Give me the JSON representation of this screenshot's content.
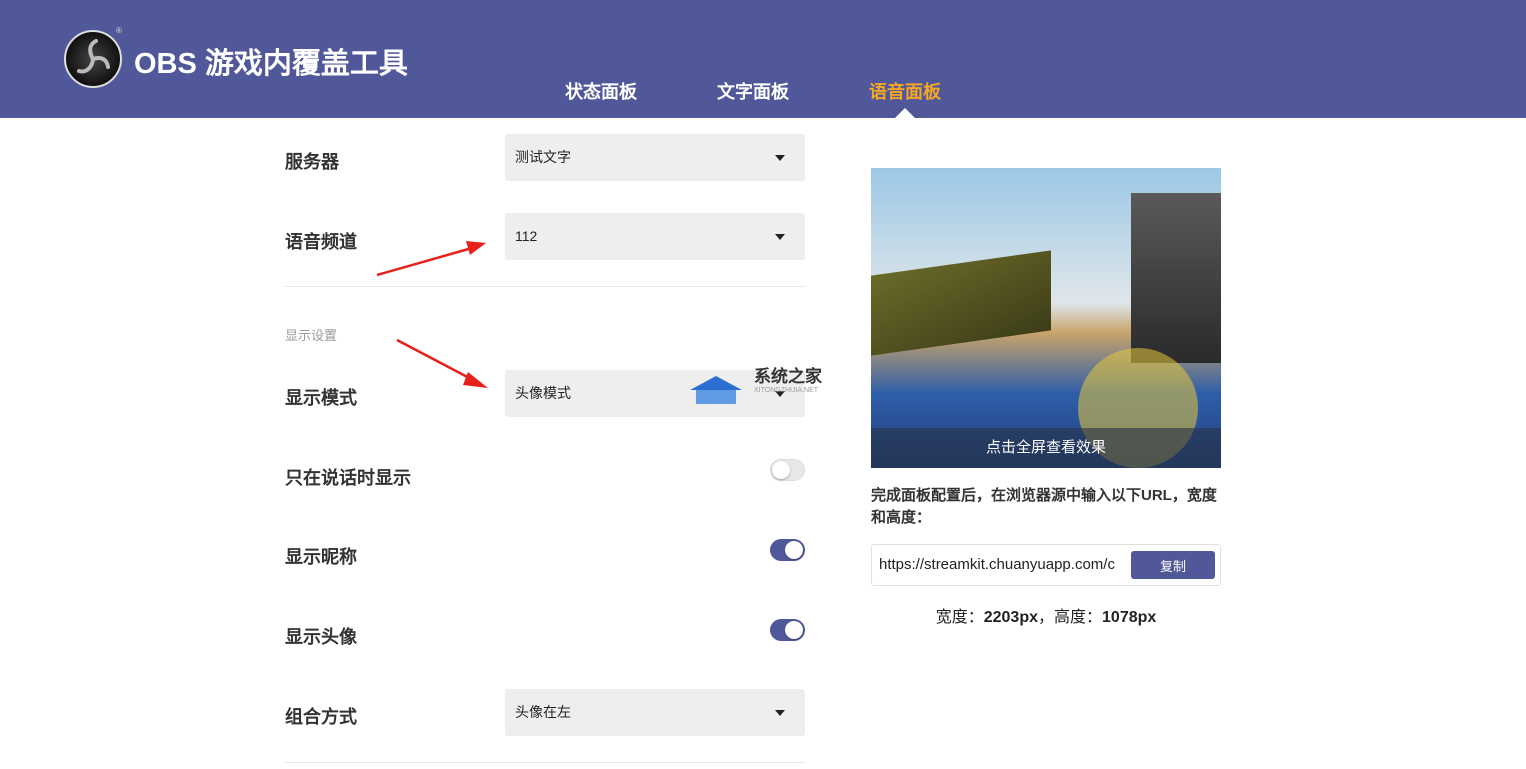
{
  "header": {
    "app_title": "OBS 游戏内覆盖工具",
    "reg_mark": "®",
    "tabs": [
      {
        "label": "状态面板"
      },
      {
        "label": "文字面板"
      },
      {
        "label": "语音面板",
        "active": true
      }
    ]
  },
  "form": {
    "server": {
      "label": "服务器",
      "value": "测试文字"
    },
    "channel": {
      "label": "语音频道",
      "value": "112"
    },
    "section_title": "显示设置",
    "display_mode": {
      "label": "显示模式",
      "value": "头像模式"
    },
    "only_speaking": {
      "label": "只在说话时显示",
      "on": false
    },
    "show_nickname": {
      "label": "显示昵称",
      "on": true
    },
    "show_avatar": {
      "label": "显示头像",
      "on": true
    },
    "layout": {
      "label": "组合方式",
      "value": "头像在左"
    }
  },
  "preview": {
    "caption": "点击全屏查看效果"
  },
  "info": {
    "text": "完成面板配置后，在浏览器源中输入以下URL，宽度和高度：",
    "url": "https://streamkit.chuanyuapp.com/c",
    "copy_label": "复制",
    "width_label": "宽度：",
    "width_value": "2203px",
    "sep": "，",
    "height_label": "高度：",
    "height_value": "1078px"
  },
  "watermark": {
    "name": "系统之家",
    "domain": "XITONGZHIJIA.NET"
  },
  "colors": {
    "brand": "#505899",
    "active_tab": "#f5a623",
    "arrow": "#e8201a"
  }
}
